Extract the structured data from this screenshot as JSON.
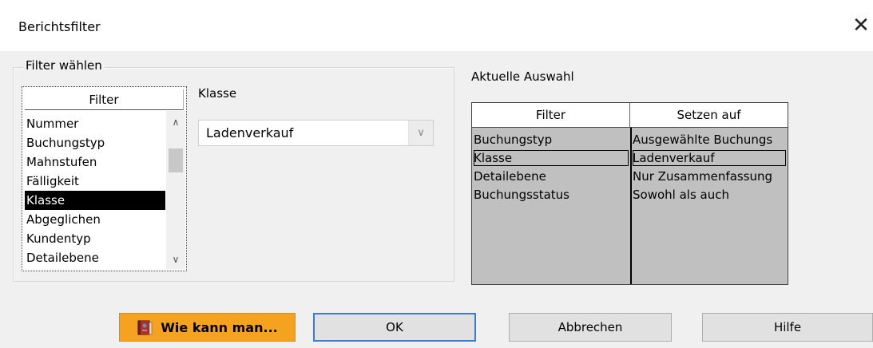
{
  "window": {
    "title": "Berichtsfilter",
    "close_icon": "close-icon"
  },
  "filter_group": {
    "label": "Filter wählen",
    "list_header": "Filter",
    "items": [
      {
        "label": "Nummer"
      },
      {
        "label": "Buchungstyp"
      },
      {
        "label": "Mahnstufen"
      },
      {
        "label": "Fälligkeit"
      },
      {
        "label": "Klasse",
        "selected": true
      },
      {
        "label": "Abgeglichen"
      },
      {
        "label": "Kundentyp"
      },
      {
        "label": "Detailebene"
      }
    ],
    "field_label": "Klasse",
    "field_value": "Ladenverkauf"
  },
  "current": {
    "label": "Aktuelle Auswahl",
    "col_filter": "Filter",
    "col_value": "Setzen auf",
    "rows": [
      {
        "filter": "Buchungstyp",
        "value": "Ausgewählte Buchungs"
      },
      {
        "filter": "Klasse",
        "value": "Ladenverkauf",
        "selected": true
      },
      {
        "filter": "Detailebene",
        "value": "Nur Zusammenfassung"
      },
      {
        "filter": "Buchungsstatus",
        "value": "Sowohl als auch"
      }
    ]
  },
  "buttons": {
    "how_to": "Wie kann man...",
    "ok": "OK",
    "cancel": "Abbrechen",
    "help": "Hilfe"
  },
  "colors": {
    "how_to_bg": "#f5a21f",
    "ok_border": "#3b7bd4",
    "grid_bg": "#c0c0c0",
    "selection": "#000000"
  }
}
